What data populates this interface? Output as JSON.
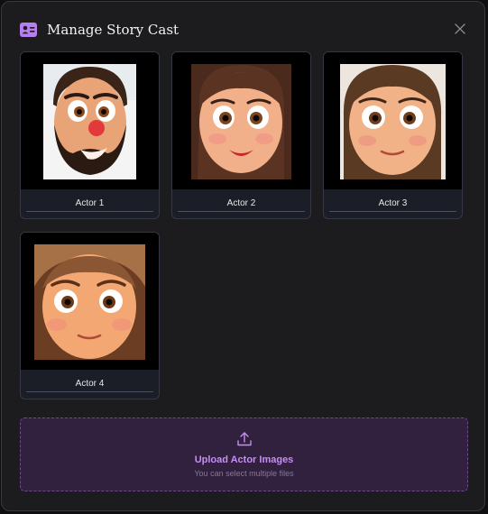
{
  "dialog": {
    "title": "Manage Story Cast",
    "header_icon": "contact-card-icon",
    "close_icon": "close-icon"
  },
  "actors": [
    {
      "label": "Actor 1"
    },
    {
      "label": "Actor 2"
    },
    {
      "label": "Actor 3"
    },
    {
      "label": "Actor 4"
    }
  ],
  "upload": {
    "title": "Upload Actor Images",
    "subtitle": "You can select multiple files",
    "icon": "upload-icon"
  },
  "colors": {
    "accent": "#c58ef2",
    "upload_bg": "#32203f",
    "modal_bg": "#1c1c1f"
  }
}
